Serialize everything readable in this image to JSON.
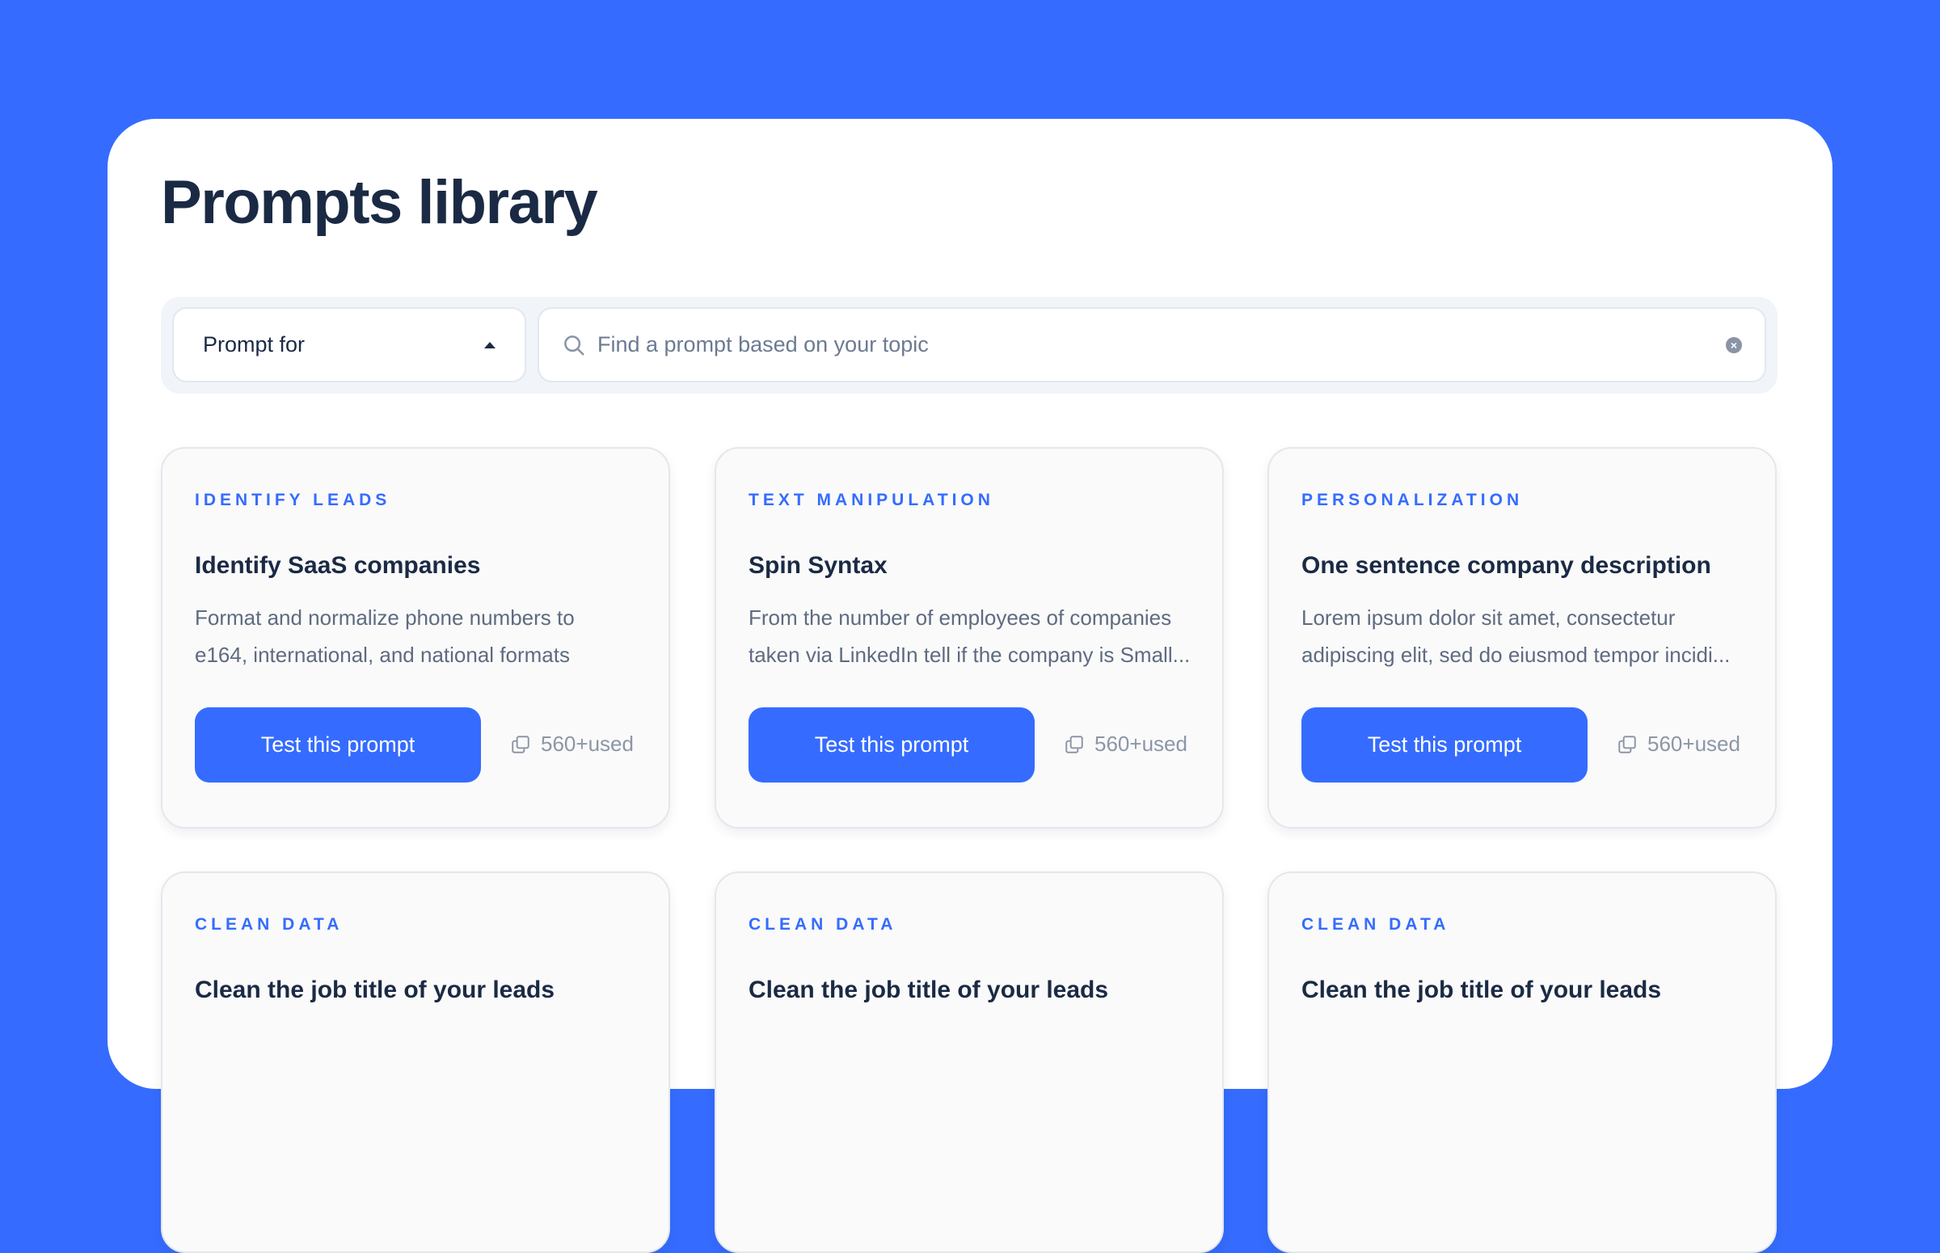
{
  "page": {
    "title": "Prompts library"
  },
  "filters": {
    "select_label": "Prompt for",
    "search_placeholder": "Find a prompt based on your topic"
  },
  "cards": [
    {
      "category": "Identify leads",
      "title": "Identify SaaS companies",
      "desc_line1": "Format and normalize phone numbers to",
      "desc_line2": "e164, international, and national formats",
      "button": "Test this prompt",
      "usage": "560+used"
    },
    {
      "category": "Text manipulation",
      "title": "Spin Syntax",
      "desc_line1": "From the number of employees of companies",
      "desc_line2": "taken via LinkedIn tell if the company is Small...",
      "button": "Test this prompt",
      "usage": "560+used"
    },
    {
      "category": "Personalization",
      "title": "One sentence company description",
      "desc_line1": "Lorem ipsum dolor sit amet, consectetur",
      "desc_line2": "adipiscing elit, sed do eiusmod tempor incidi...",
      "button": "Test this prompt",
      "usage": "560+used"
    },
    {
      "category": "Clean data",
      "title": "Clean the job title of your leads"
    },
    {
      "category": "Clean data",
      "title": "Clean the job title of your leads"
    },
    {
      "category": "Clean data",
      "title": "Clean the job title of your leads"
    }
  ],
  "colors": {
    "background": "#356cff",
    "accent": "#356cff",
    "heading": "#1b2a44"
  },
  "icons": {
    "search": "search-icon",
    "clear": "clear-icon",
    "caret": "caret-up-icon",
    "copy": "copy-icon"
  }
}
